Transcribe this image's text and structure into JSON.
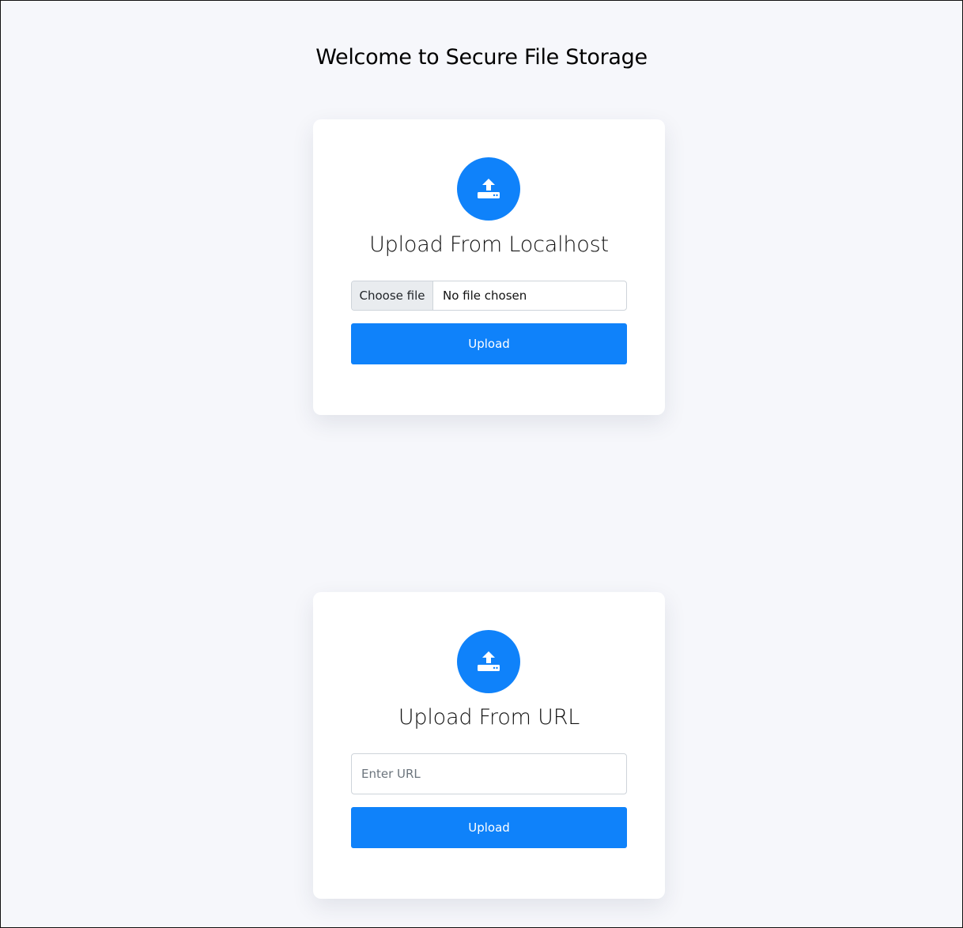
{
  "page": {
    "title": "Welcome to Secure File Storage"
  },
  "local_upload": {
    "icon": "upload-icon",
    "title": "Upload From Localhost",
    "choose_file_label": "Choose file",
    "file_status": "No file chosen",
    "upload_label": "Upload"
  },
  "url_upload": {
    "icon": "upload-icon",
    "title": "Upload From URL",
    "url_placeholder": "Enter URL",
    "url_value": "",
    "upload_label": "Upload"
  },
  "colors": {
    "accent": "#0f82fa",
    "background": "#f6f7fb",
    "card": "#ffffff"
  }
}
